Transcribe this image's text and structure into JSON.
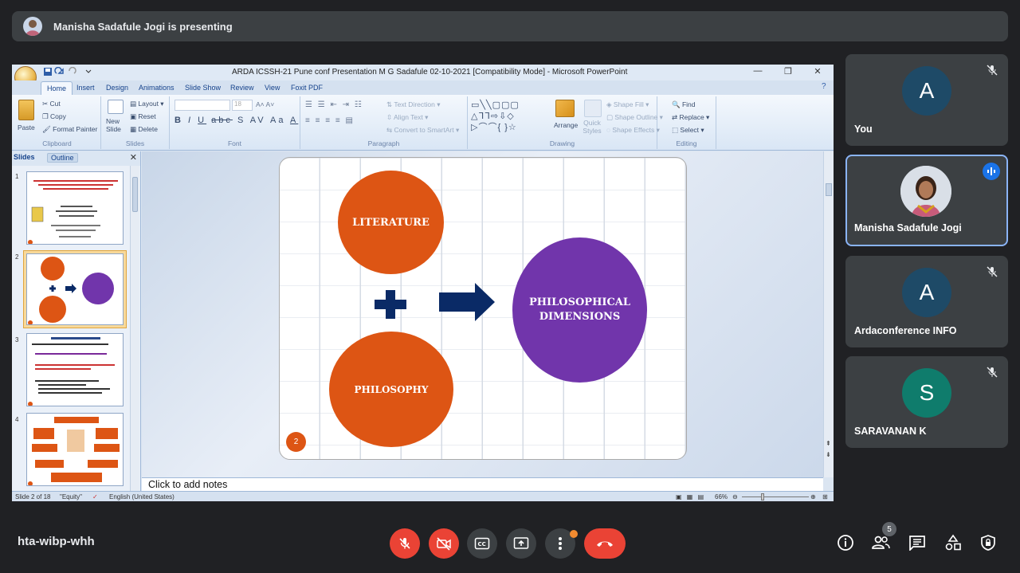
{
  "presenting_bar": {
    "text": "Manisha Sadafule Jogi is presenting"
  },
  "powerpoint": {
    "window_title": "ARDA ICSSH-21 Pune  conf Presentation M G Sadafule 02-10-2021 [Compatibility Mode] - Microsoft PowerPoint",
    "tabs": [
      "Home",
      "Insert",
      "Design",
      "Animations",
      "Slide Show",
      "Review",
      "View",
      "Foxit PDF"
    ],
    "ribbon": {
      "clipboard": {
        "paste": "Paste",
        "cut": "Cut",
        "copy": "Copy",
        "format_painter": "Format Painter",
        "label": "Clipboard"
      },
      "slides": {
        "new_slide": "New Slide",
        "layout": "Layout",
        "reset": "Reset",
        "delete": "Delete",
        "label": "Slides"
      },
      "font": {
        "size": "18",
        "label": "Font"
      },
      "paragraph": {
        "text_direction": "Text Direction",
        "align_text": "Align Text",
        "convert_smartart": "Convert to SmartArt",
        "label": "Paragraph"
      },
      "drawing": {
        "arrange": "Arrange",
        "quick_styles": "Quick Styles",
        "shape_fill": "Shape Fill",
        "shape_outline": "Shape Outline",
        "shape_effects": "Shape Effects",
        "label": "Drawing"
      },
      "editing": {
        "find": "Find",
        "replace": "Replace",
        "select": "Select",
        "label": "Editing"
      }
    },
    "panel_tabs": {
      "slides": "Slides",
      "outline": "Outline"
    },
    "thumb_numbers": [
      "1",
      "2",
      "3",
      "4"
    ],
    "slide": {
      "circle_1": "LITERATURE",
      "circle_2": "PHILOSOPHY",
      "circle_3_line1": "PHILOSOPHICAL",
      "circle_3_line2": "DIMENSIONS",
      "slide_number": "2"
    },
    "notes_placeholder": "Click to add notes",
    "status": {
      "slide_of": "Slide 2 of 18",
      "theme": "\"Equity\"",
      "language": "English (United States)",
      "zoom": "66%"
    }
  },
  "participants": [
    {
      "initial": "A",
      "name": "You",
      "color": "#1e4a67"
    },
    {
      "initial": "",
      "name": "Manisha Sadafule Jogi",
      "color": "#5a6470"
    },
    {
      "initial": "A",
      "name": "Ardaconference INFO",
      "color": "#1e4a67"
    },
    {
      "initial": "S",
      "name": "SARAVANAN K",
      "color": "#0f7c6c"
    }
  ],
  "meeting_code": "hta-wibp-whh",
  "people_count": "5",
  "colors": {
    "accent": "#1a73e8",
    "danger": "#ea4335",
    "orange": "#dd5514",
    "purple": "#7135ab"
  }
}
